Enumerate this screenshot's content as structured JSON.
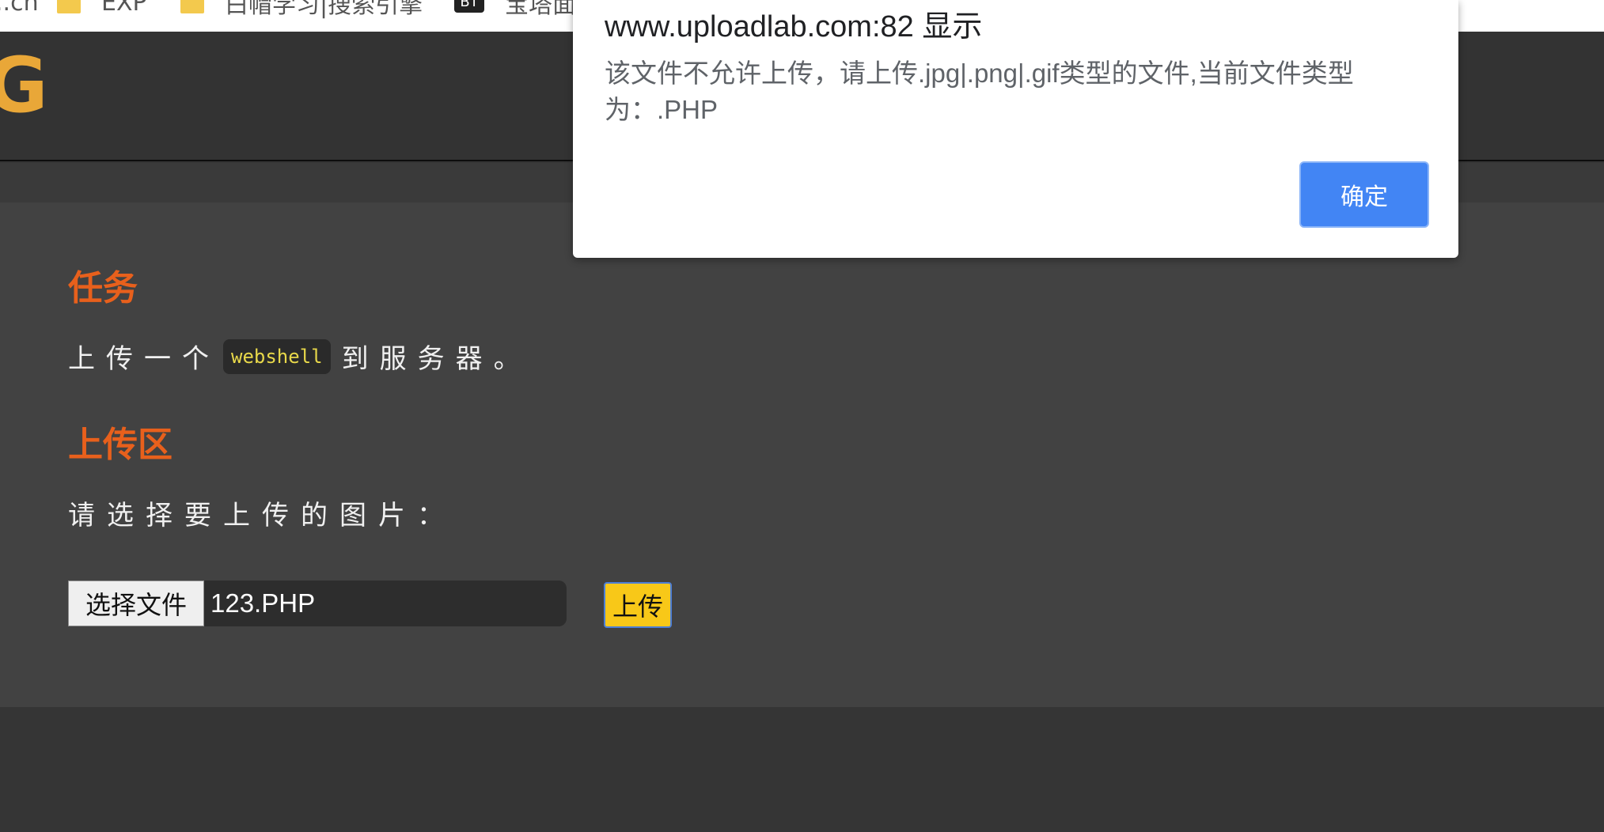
{
  "bookmarks": [
    {
      "label": "..ch",
      "icon": "none"
    },
    {
      "label": "EXP",
      "icon": "folder-icon"
    },
    {
      "label": "白帽学习|搜索引擎",
      "icon": "folder-icon"
    },
    {
      "label": "宝塔面",
      "icon": "bt-icon",
      "icon_text": "BT"
    }
  ],
  "header": {
    "logo_glyph": "G"
  },
  "main": {
    "task_title": "任务",
    "task_desc_before": "上传一个",
    "task_code": "webshell",
    "task_desc_after": "到服务器。",
    "upload_title": "上传区",
    "upload_prompt": "请选择要上传的图片：",
    "choose_file_label": "选择文件",
    "file_name": "123.PHP",
    "upload_button_label": "上传"
  },
  "dialog": {
    "title": "www.uploadlab.com:82 显示",
    "message": "该文件不允许上传，请上传.jpg|.png|.gif类型的文件,当前文件类型为：.PHP",
    "ok_label": "确定"
  },
  "colors": {
    "accent_orange": "#e8601c",
    "upload_button": "#f8c818",
    "dialog_ok": "#4285f4",
    "logo": "#e9a738"
  }
}
